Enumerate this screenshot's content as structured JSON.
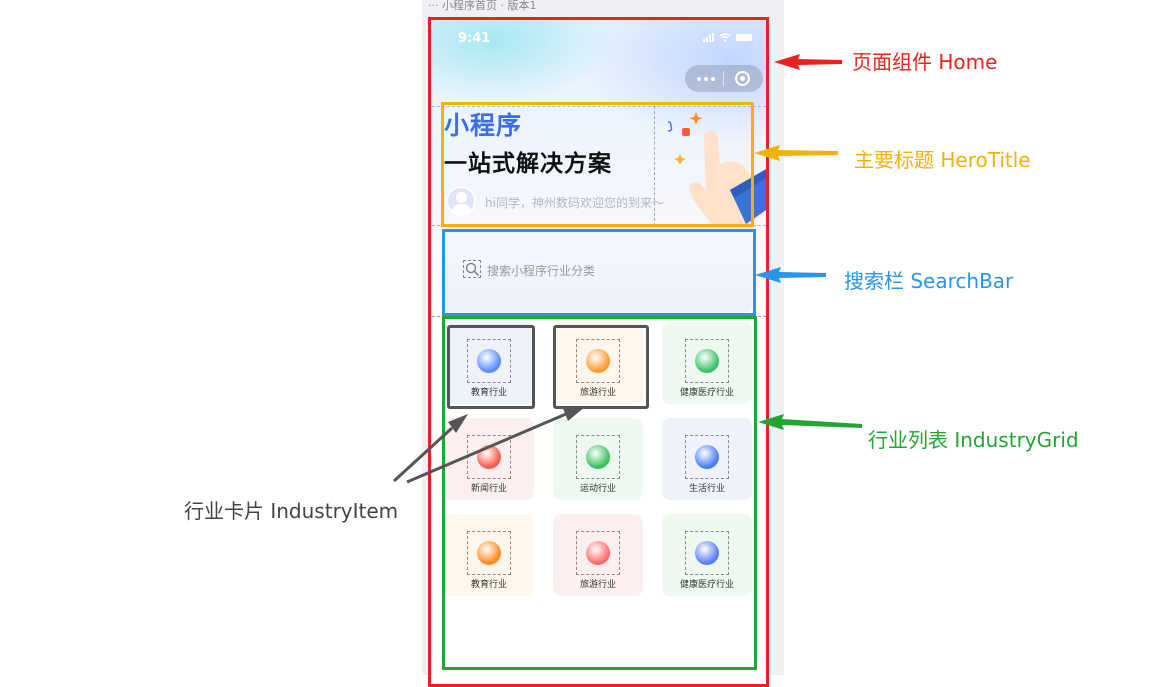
{
  "frame_caption": "小程序首页 · 版本1",
  "status": {
    "time": "9:41"
  },
  "hero": {
    "title_small": "小程序",
    "title_big": "一站式解决方案",
    "greeting": "hi同学，神州数码欢迎您的到来～"
  },
  "search": {
    "placeholder": "搜索小程序行业分类"
  },
  "industries": [
    {
      "label": "教育行业",
      "bg": "#eef3fb",
      "ball": "#5b8cff"
    },
    {
      "label": "旅游行业",
      "bg": "#fdf6ea",
      "ball": "#ff9a2e"
    },
    {
      "label": "健康医疗行业",
      "bg": "#eef7f0",
      "ball": "#3cc36a"
    },
    {
      "label": "新闻行业",
      "bg": "#fbf0ef",
      "ball": "#ff5a4a"
    },
    {
      "label": "运动行业",
      "bg": "#eef7f0",
      "ball": "#39c25c"
    },
    {
      "label": "生活行业",
      "bg": "#eef2fb",
      "ball": "#4a7df5"
    },
    {
      "label": "教育行业",
      "bg": "#fdf6ea",
      "ball": "#ff8a1e"
    },
    {
      "label": "旅游行业",
      "bg": "#fbf0ef",
      "ball": "#ff6a6a"
    },
    {
      "label": "健康医疗行业",
      "bg": "#eef7f0",
      "ball": "#5b7df5"
    }
  ],
  "annotations": {
    "home": "页面组件 Home",
    "hero_title": "主要标题 HeroTitle",
    "search_bar": "搜索栏 SearchBar",
    "industry_grid": "行业列表 IndustryGrid",
    "industry_item": "行业卡片 IndustryItem"
  },
  "colors": {
    "home": "#e8231f",
    "hero_title": "#f5b10a",
    "search_bar": "#2a94e8",
    "industry_grid": "#23a532",
    "industry_item": "#555555"
  }
}
